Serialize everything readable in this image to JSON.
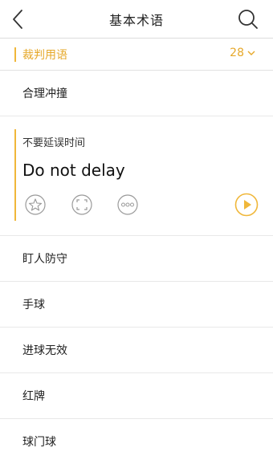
{
  "header": {
    "title": "基本术语",
    "back_icon": "back-arrow-icon",
    "search_icon": "search-icon"
  },
  "section": {
    "label": "裁判用语",
    "count": "28",
    "chevron_icon": "chevron-down-icon"
  },
  "items_before": [
    {
      "label": "合理冲撞"
    }
  ],
  "expanded": {
    "chinese": "不要延误时间",
    "english": "Do not delay",
    "icons": [
      "star-icon",
      "expand-icon",
      "more-icon",
      "play-icon"
    ]
  },
  "items_after": [
    {
      "label": "盯人防守"
    },
    {
      "label": "手球"
    },
    {
      "label": "进球无效"
    },
    {
      "label": "红牌"
    },
    {
      "label": "球门球"
    }
  ],
  "colors": {
    "accent": "#f0b73a",
    "accent_text": "#e6a82a",
    "icon_gray": "#9a9a9a",
    "divider": "#e8e8e8"
  }
}
